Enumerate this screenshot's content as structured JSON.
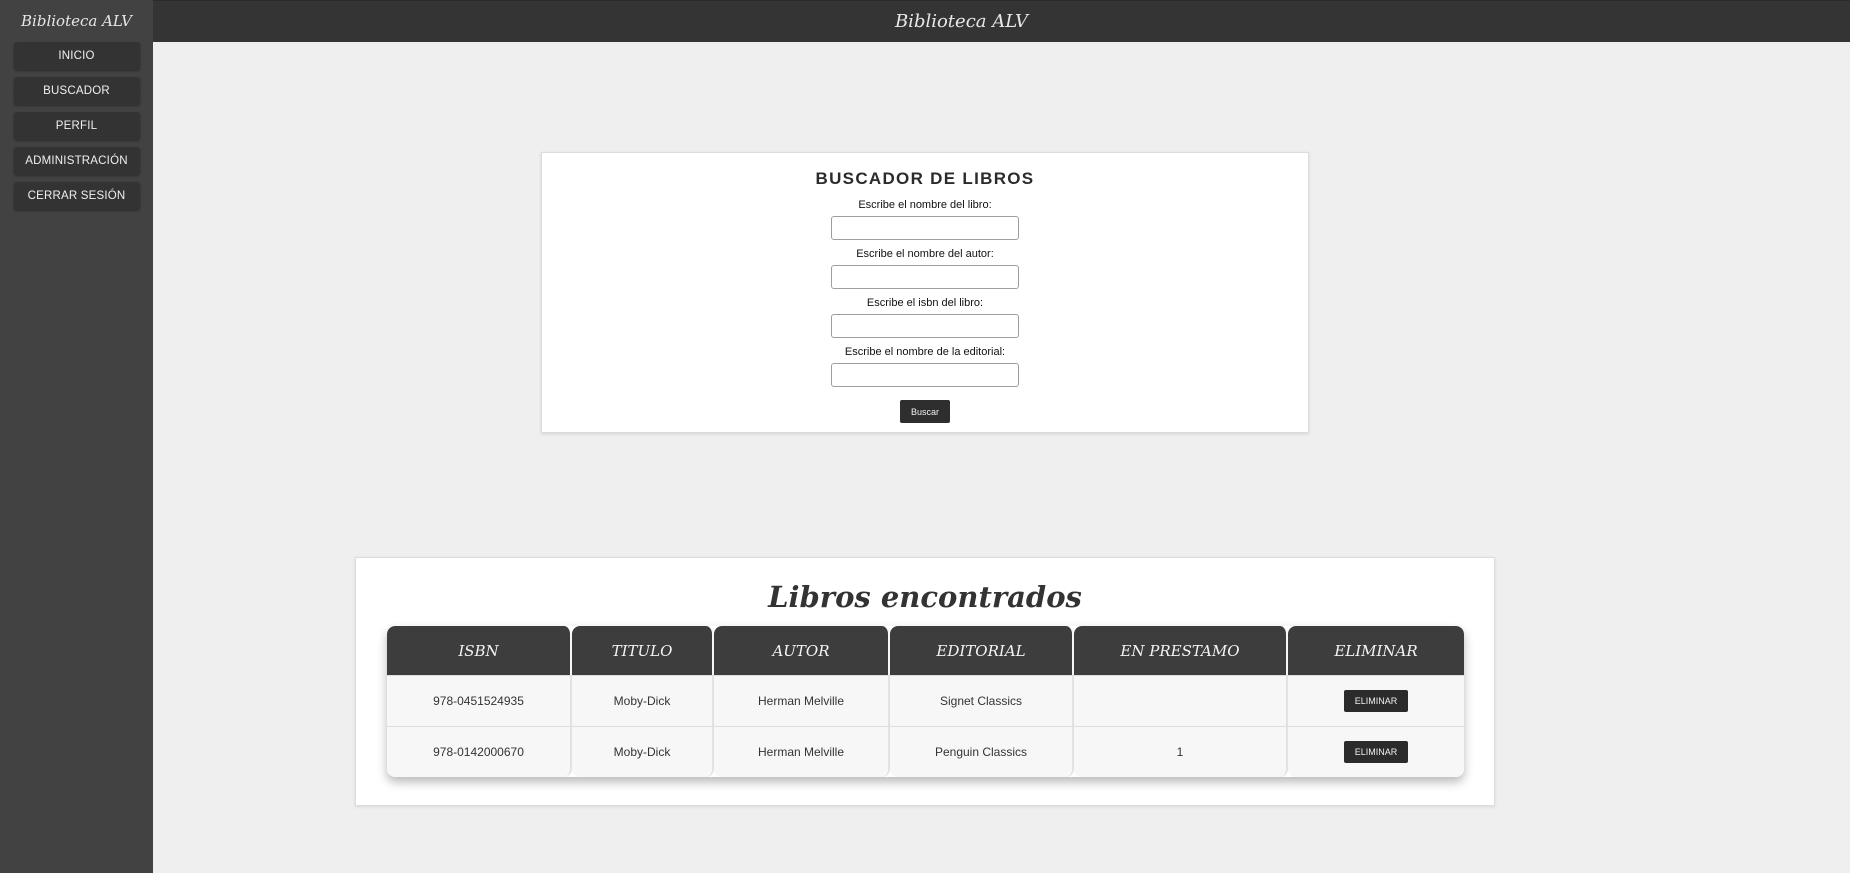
{
  "app": {
    "brand": "Biblioteca ALV",
    "header_title": "Biblioteca ALV"
  },
  "sidebar": {
    "items": [
      {
        "label": "INICIO"
      },
      {
        "label": "BUSCADOR"
      },
      {
        "label": "PERFIL"
      },
      {
        "label": "ADMINISTRACIÓN"
      },
      {
        "label": "CERRAR SESIÓN"
      }
    ]
  },
  "search": {
    "title": "BUSCADOR DE LIBROS",
    "fields": [
      {
        "label": "Escribe el nombre del libro:",
        "value": ""
      },
      {
        "label": "Escribe el nombre del autor:",
        "value": ""
      },
      {
        "label": "Escribe el isbn del libro:",
        "value": ""
      },
      {
        "label": "Escribe el nombre de la editorial:",
        "value": ""
      }
    ],
    "button_label": "Buscar"
  },
  "results": {
    "title": "Libros encontrados",
    "headers": [
      "ISBN",
      "TITULO",
      "AUTOR",
      "EDITORIAL",
      "EN PRESTAMO",
      "ELIMINAR"
    ],
    "rows": [
      {
        "isbn": "978-0451524935",
        "titulo": "Moby-Dick",
        "autor": "Herman Melville",
        "editorial": "Signet Classics",
        "prestamo": "",
        "action": "ELIMINAR"
      },
      {
        "isbn": "978-0142000670",
        "titulo": "Moby-Dick",
        "autor": "Herman Melville",
        "editorial": "Penguin Classics",
        "prestamo": "1",
        "action": "ELIMINAR"
      }
    ]
  },
  "colors": {
    "sidebar_bg": "#424242",
    "topbar_bg": "#343434",
    "page_bg": "#efefef",
    "button_bg": "#2e2e2e"
  }
}
